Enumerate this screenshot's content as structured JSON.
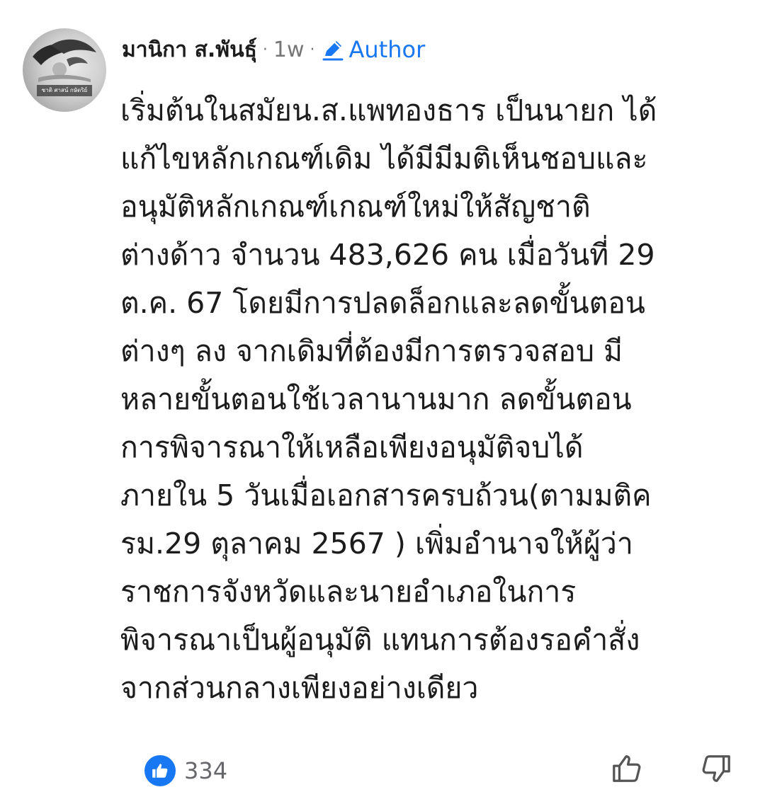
{
  "comment": {
    "author": "มานิกา ส.พันธุ์",
    "separator": "·",
    "time": "1w",
    "author_badge": "Author",
    "avatar_caption": "ชาติ ศาสน์ กษัตริย์",
    "text": "เริ่มต้นในสมัยน.ส.แพทองธาร เป็นนายก ได้\nแก้ไขหลักเกณฑ์เดิม ได้มีมีมติเห็นชอบและ\nอนุมัติหลักเกณฑ์เกณฑ์ใหม่ให้สัญชาติ\nต่างด้าว จำนวน 483,626 คน เมื่อวันที่ 29\nต.ค. 67 โดยมีการปลดล็อกและลดขั้นตอน\nต่างๆ ลง จากเดิมที่ต้องมีการตรวจสอบ มี\nหลายขั้นตอนใช้เวลานานมาก ลดขั้นตอน\nการพิจารณาให้เหลือเพียงอนุมัติจบได้\nภายใน 5 วันเมื่อเอกสารครบถ้วน(ตามมติค\nรม.29 ตุลาคม 2567 ) เพิ่มอำนาจให้ผู้ว่า\nราชการจังหวัดและนายอำเภอในการ\nพิจารณาเป็นผู้อนุมัติ แทนการต้องรอคำสั่ง\nจากส่วนกลางเพียงอย่างเดียว"
  },
  "reactions": {
    "like_count": "334",
    "icons": {
      "like": "thumbs-up-icon",
      "upvote": "thumbs-up-outline-icon",
      "downvote": "thumbs-down-outline-icon",
      "author": "pencil-icon"
    }
  },
  "colors": {
    "accent": "#1877f2",
    "text": "#1c1c1c",
    "muted": "#767676"
  }
}
